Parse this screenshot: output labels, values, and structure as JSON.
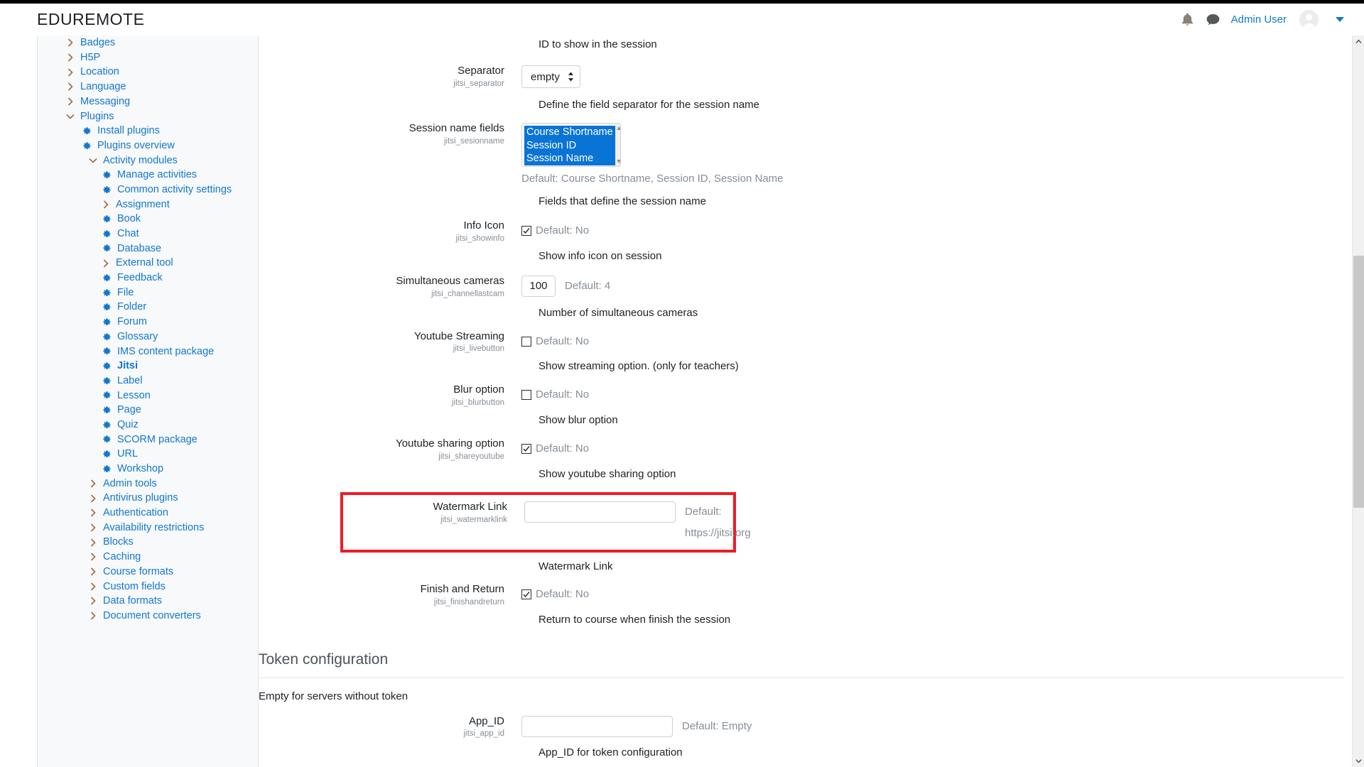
{
  "header": {
    "brand": "EDUREMOTE",
    "notifications_icon": "bell-icon",
    "messages_icon": "message-icon",
    "user_name": "Admin User",
    "avatar_label": "avatar",
    "caret_label": "user-menu-chevron"
  },
  "sidebar": {
    "items": [
      {
        "label": "Badges",
        "depth": 0,
        "marker": "chevron-right",
        "active": false
      },
      {
        "label": "H5P",
        "depth": 0,
        "marker": "chevron-right",
        "active": false
      },
      {
        "label": "Location",
        "depth": 0,
        "marker": "chevron-right",
        "active": false
      },
      {
        "label": "Language",
        "depth": 0,
        "marker": "chevron-right",
        "active": false
      },
      {
        "label": "Messaging",
        "depth": 0,
        "marker": "chevron-right",
        "active": false
      },
      {
        "label": "Plugins",
        "depth": 0,
        "marker": "chevron-down",
        "active": false
      },
      {
        "label": "Install plugins",
        "depth": 1,
        "marker": "gear",
        "active": false
      },
      {
        "label": "Plugins overview",
        "depth": 1,
        "marker": "gear",
        "active": false
      },
      {
        "label": "Activity modules",
        "depth": 2,
        "marker": "chevron-down",
        "active": false
      },
      {
        "label": "Manage activities",
        "depth": 3,
        "marker": "gear",
        "active": false
      },
      {
        "label": "Common activity settings",
        "depth": 3,
        "marker": "gear",
        "active": false
      },
      {
        "label": "Assignment",
        "depth": 3,
        "marker": "chevron-right",
        "active": false
      },
      {
        "label": "Book",
        "depth": 3,
        "marker": "gear",
        "active": false
      },
      {
        "label": "Chat",
        "depth": 3,
        "marker": "gear",
        "active": false
      },
      {
        "label": "Database",
        "depth": 3,
        "marker": "gear",
        "active": false
      },
      {
        "label": "External tool",
        "depth": 3,
        "marker": "chevron-right",
        "active": false
      },
      {
        "label": "Feedback",
        "depth": 3,
        "marker": "gear",
        "active": false
      },
      {
        "label": "File",
        "depth": 3,
        "marker": "gear",
        "active": false
      },
      {
        "label": "Folder",
        "depth": 3,
        "marker": "gear",
        "active": false
      },
      {
        "label": "Forum",
        "depth": 3,
        "marker": "gear",
        "active": false
      },
      {
        "label": "Glossary",
        "depth": 3,
        "marker": "gear",
        "active": false
      },
      {
        "label": "IMS content package",
        "depth": 3,
        "marker": "gear",
        "active": false
      },
      {
        "label": "Jitsi",
        "depth": 3,
        "marker": "gear",
        "active": true
      },
      {
        "label": "Label",
        "depth": 3,
        "marker": "gear",
        "active": false
      },
      {
        "label": "Lesson",
        "depth": 3,
        "marker": "gear",
        "active": false
      },
      {
        "label": "Page",
        "depth": 3,
        "marker": "gear",
        "active": false
      },
      {
        "label": "Quiz",
        "depth": 3,
        "marker": "gear",
        "active": false
      },
      {
        "label": "SCORM package",
        "depth": 3,
        "marker": "gear",
        "active": false
      },
      {
        "label": "URL",
        "depth": 3,
        "marker": "gear",
        "active": false
      },
      {
        "label": "Workshop",
        "depth": 3,
        "marker": "gear",
        "active": false
      },
      {
        "label": "Admin tools",
        "depth": 2,
        "marker": "chevron-right",
        "active": false
      },
      {
        "label": "Antivirus plugins",
        "depth": 2,
        "marker": "chevron-right",
        "active": false
      },
      {
        "label": "Authentication",
        "depth": 2,
        "marker": "chevron-right",
        "active": false
      },
      {
        "label": "Availability restrictions",
        "depth": 2,
        "marker": "chevron-right",
        "active": false
      },
      {
        "label": "Blocks",
        "depth": 2,
        "marker": "chevron-right",
        "active": false
      },
      {
        "label": "Caching",
        "depth": 2,
        "marker": "chevron-right",
        "active": false
      },
      {
        "label": "Course formats",
        "depth": 2,
        "marker": "chevron-right",
        "active": false
      },
      {
        "label": "Custom fields",
        "depth": 2,
        "marker": "chevron-right",
        "active": false
      },
      {
        "label": "Data formats",
        "depth": 2,
        "marker": "chevron-right",
        "active": false
      },
      {
        "label": "Document converters",
        "depth": 2,
        "marker": "chevron-right",
        "active": false
      }
    ]
  },
  "main": {
    "top_partial_desc": "ID to show in the session",
    "separator": {
      "label": "Separator",
      "key": "jitsi_separator",
      "value": "empty",
      "options": [
        "empty"
      ],
      "description": "Define the field separator for the session name"
    },
    "session_name_fields": {
      "label": "Session name fields",
      "key": "jitsi_sesionname",
      "options": [
        {
          "text": "Course Shortname",
          "selected": true
        },
        {
          "text": "Session ID",
          "selected": true
        },
        {
          "text": "Session Name",
          "selected": true
        }
      ],
      "default": "Default: Course Shortname, Session ID, Session Name",
      "description": "Fields that define the session name"
    },
    "info_icon": {
      "label": "Info Icon",
      "key": "jitsi_showinfo",
      "checked": true,
      "default": "Default: No",
      "description": "Show info icon on session"
    },
    "simultaneous_cameras": {
      "label": "Simultaneous cameras",
      "key": "jitsi_channellastcam",
      "value": "100",
      "default": "Default: 4",
      "description": "Number of simultaneous cameras"
    },
    "youtube_streaming": {
      "label": "Youtube Streaming",
      "key": "jitsi_livebutton",
      "checked": false,
      "default": "Default: No",
      "description": "Show streaming option. (only for teachers)"
    },
    "blur_option": {
      "label": "Blur option",
      "key": "jitsi_blurbutton",
      "checked": false,
      "default": "Default: No",
      "description": "Show blur option"
    },
    "youtube_sharing_option": {
      "label": "Youtube sharing option",
      "key": "jitsi_shareyoutube",
      "checked": true,
      "default": "Default: No",
      "description": "Show youtube sharing option"
    },
    "watermark_link": {
      "label": "Watermark Link",
      "key": "jitsi_watermarklink",
      "value": "",
      "placeholder": "",
      "default": "Default: https://jitsi.org",
      "description": "Watermark Link",
      "highlight_color": "#ee1b24"
    },
    "finish_and_return": {
      "label": "Finish and Return",
      "key": "jitsi_finishandreturn",
      "checked": true,
      "default": "Default: No",
      "description": "Return to course when finish the session"
    },
    "token_section": {
      "heading": "Token configuration",
      "note": "Empty for servers without token"
    },
    "app_id": {
      "label": "App_ID",
      "key": "jitsi_app_id",
      "value": "",
      "default": "Default: Empty",
      "description": "App_ID for token configuration"
    }
  },
  "scrollbar": {
    "up_icon": "scroll-up-arrow",
    "down_icon": "scroll-down-arrow"
  }
}
